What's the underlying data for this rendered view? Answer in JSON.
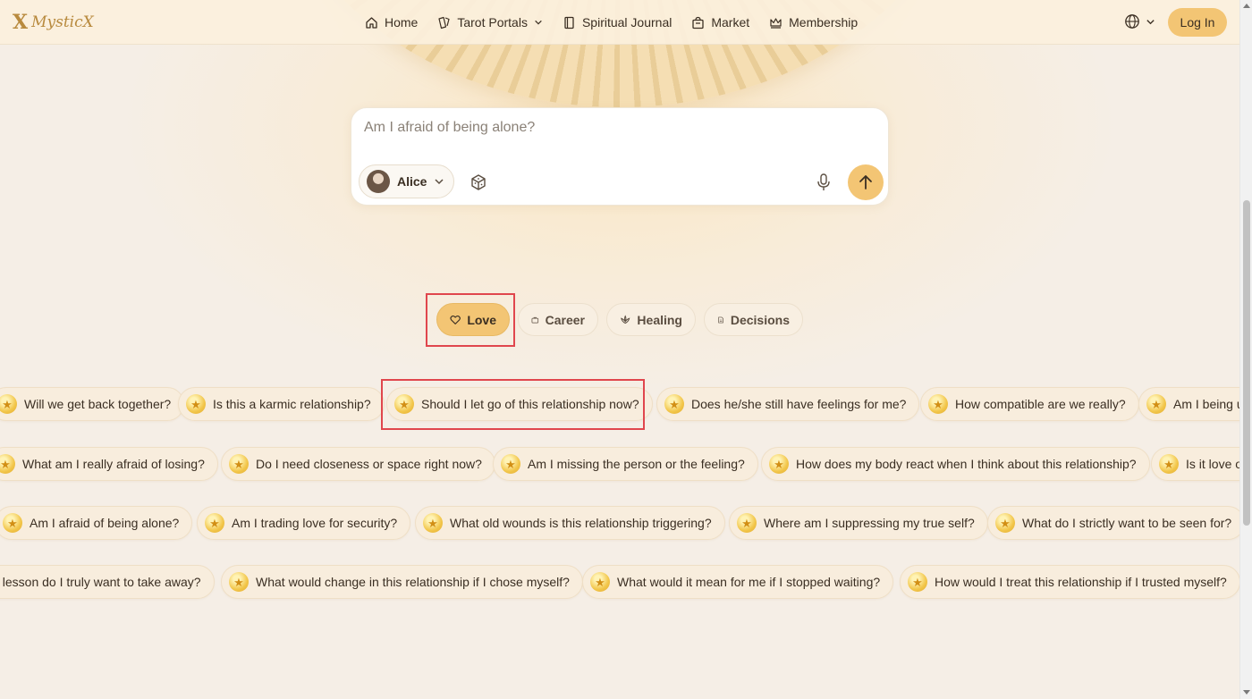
{
  "brand": {
    "name": "MysticX",
    "mark": "X"
  },
  "nav": {
    "items": [
      {
        "label": "Home",
        "icon": "home-icon"
      },
      {
        "label": "Tarot Portals",
        "icon": "tarot-card-icon",
        "dropdown": true
      },
      {
        "label": "Spiritual Journal",
        "icon": "journal-icon"
      },
      {
        "label": "Market",
        "icon": "bag-icon"
      },
      {
        "label": "Membership",
        "icon": "crown-icon"
      }
    ],
    "login_label": "Log In"
  },
  "composer": {
    "placeholder": "Am I afraid of being alone?",
    "persona_name": "Alice"
  },
  "categories": [
    {
      "label": "Love",
      "icon": "heart-icon",
      "active": true
    },
    {
      "label": "Career",
      "icon": "briefcase-icon",
      "active": false
    },
    {
      "label": "Healing",
      "icon": "lotus-icon",
      "active": false
    },
    {
      "label": "Decisions",
      "icon": "document-icon",
      "active": false
    }
  ],
  "questions": {
    "row1": [
      "Will we get back together?",
      "Is this a karmic relationship?",
      "Should I let go of this relationship now?",
      "Does he/she still have feelings for me?",
      "How compatible are we really?",
      "Am I being u"
    ],
    "row2": [
      "What am I really afraid of losing?",
      "Do I need closeness or space right now?",
      "Am I missing the person or the feeling?",
      "How does my body react when I think about this relationship?",
      "Is it love o"
    ],
    "row3": [
      "Am I afraid of being alone?",
      "Am I trading love for security?",
      "What old wounds is this relationship triggering?",
      "Where am I suppressing my true self?",
      "What do I strictly want to be seen for?"
    ],
    "row4": [
      "t lesson do I truly want to take away?",
      "What would change in this relationship if I chose myself?",
      "What would it mean for me if I stopped waiting?",
      "How would I treat this relationship if I trusted myself?"
    ]
  },
  "colors": {
    "accent": "#f3c574",
    "highlight": "#e0464d",
    "background": "#f6efe6"
  }
}
